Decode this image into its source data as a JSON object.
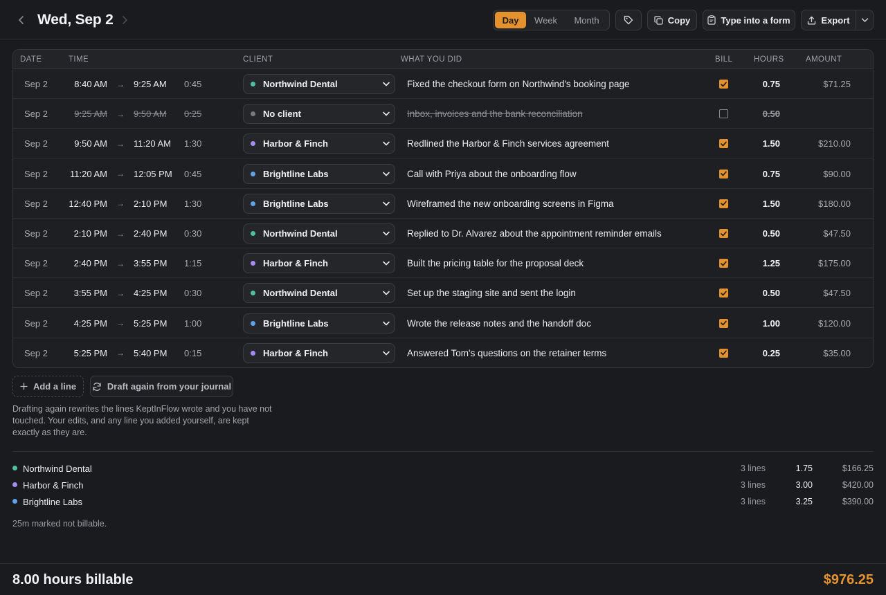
{
  "header": {
    "title": "Wed, Sep 2",
    "views": [
      "Day",
      "Week",
      "Month"
    ],
    "active_view": "Day",
    "copy_label": "Copy",
    "form_label": "Type into a form",
    "export_label": "Export"
  },
  "table": {
    "columns": {
      "date": "DATE",
      "time": "TIME",
      "client": "CLIENT",
      "what": "WHAT YOU DID",
      "bill": "BILL",
      "hours": "HOURS",
      "amount": "AMOUNT"
    },
    "arrow": "→",
    "rows": [
      {
        "date": "Sep 2",
        "start": "8:40 AM",
        "end": "9:25 AM",
        "duration": "0:45",
        "client": "Northwind Dental",
        "client_color": "#4fc0a4",
        "description": "Fixed the checkout form on Northwind's booking page",
        "billable": true,
        "hours": "0.75",
        "amount": "$71.25"
      },
      {
        "date": "Sep 2",
        "start": "9:25 AM",
        "end": "9:50 AM",
        "duration": "0:25",
        "client": "No client",
        "client_color": "#7a7b80",
        "description": "Inbox, invoices and the bank reconciliation",
        "billable": false,
        "hours": "0.50",
        "amount": ""
      },
      {
        "date": "Sep 2",
        "start": "9:50 AM",
        "end": "11:20 AM",
        "duration": "1:30",
        "client": "Harbor & Finch",
        "client_color": "#a48cf0",
        "description": "Redlined the Harbor & Finch services agreement",
        "billable": true,
        "hours": "1.50",
        "amount": "$210.00"
      },
      {
        "date": "Sep 2",
        "start": "11:20 AM",
        "end": "12:05 PM",
        "duration": "0:45",
        "client": "Brightline Labs",
        "client_color": "#5fa2ea",
        "description": "Call with Priya about the onboarding flow",
        "billable": true,
        "hours": "0.75",
        "amount": "$90.00"
      },
      {
        "date": "Sep 2",
        "start": "12:40 PM",
        "end": "2:10 PM",
        "duration": "1:30",
        "client": "Brightline Labs",
        "client_color": "#5fa2ea",
        "description": "Wireframed the new onboarding screens in Figma",
        "billable": true,
        "hours": "1.50",
        "amount": "$180.00"
      },
      {
        "date": "Sep 2",
        "start": "2:10 PM",
        "end": "2:40 PM",
        "duration": "0:30",
        "client": "Northwind Dental",
        "client_color": "#4fc0a4",
        "description": "Replied to Dr. Alvarez about the appointment reminder emails",
        "billable": true,
        "hours": "0.50",
        "amount": "$47.50"
      },
      {
        "date": "Sep 2",
        "start": "2:40 PM",
        "end": "3:55 PM",
        "duration": "1:15",
        "client": "Harbor & Finch",
        "client_color": "#a48cf0",
        "description": "Built the pricing table for the proposal deck",
        "billable": true,
        "hours": "1.25",
        "amount": "$175.00"
      },
      {
        "date": "Sep 2",
        "start": "3:55 PM",
        "end": "4:25 PM",
        "duration": "0:30",
        "client": "Northwind Dental",
        "client_color": "#4fc0a4",
        "description": "Set up the staging site and sent the login",
        "billable": true,
        "hours": "0.50",
        "amount": "$47.50"
      },
      {
        "date": "Sep 2",
        "start": "4:25 PM",
        "end": "5:25 PM",
        "duration": "1:00",
        "client": "Brightline Labs",
        "client_color": "#5fa2ea",
        "description": "Wrote the release notes and the handoff doc",
        "billable": true,
        "hours": "1.00",
        "amount": "$120.00"
      },
      {
        "date": "Sep 2",
        "start": "5:25 PM",
        "end": "5:40 PM",
        "duration": "0:15",
        "client": "Harbor & Finch",
        "client_color": "#a48cf0",
        "description": "Answered Tom's questions on the retainer terms",
        "billable": true,
        "hours": "0.25",
        "amount": "$35.00"
      }
    ]
  },
  "actions": {
    "add_line": "Add a line",
    "redraft": "Draft again from your journal",
    "hint": "Drafting again rewrites the lines KeptInFlow wrote and you have not touched. Your edits, and any line you added yourself, are kept exactly as they are."
  },
  "summary": {
    "clients": [
      {
        "name": "Northwind Dental",
        "color": "#4fc0a4",
        "lines": "3 lines",
        "hours": "1.75",
        "amount": "$166.25"
      },
      {
        "name": "Harbor & Finch",
        "color": "#a48cf0",
        "lines": "3 lines",
        "hours": "3.00",
        "amount": "$420.00"
      },
      {
        "name": "Brightline Labs",
        "color": "#5fa2ea",
        "lines": "3 lines",
        "hours": "3.25",
        "amount": "$390.00"
      }
    ],
    "non_billable": "25m marked not billable."
  },
  "footer": {
    "hours_billable": "8.00 hours billable",
    "total": "$976.25"
  },
  "colors": {
    "accent": "#e4912f",
    "background": "#1a1b1e"
  }
}
